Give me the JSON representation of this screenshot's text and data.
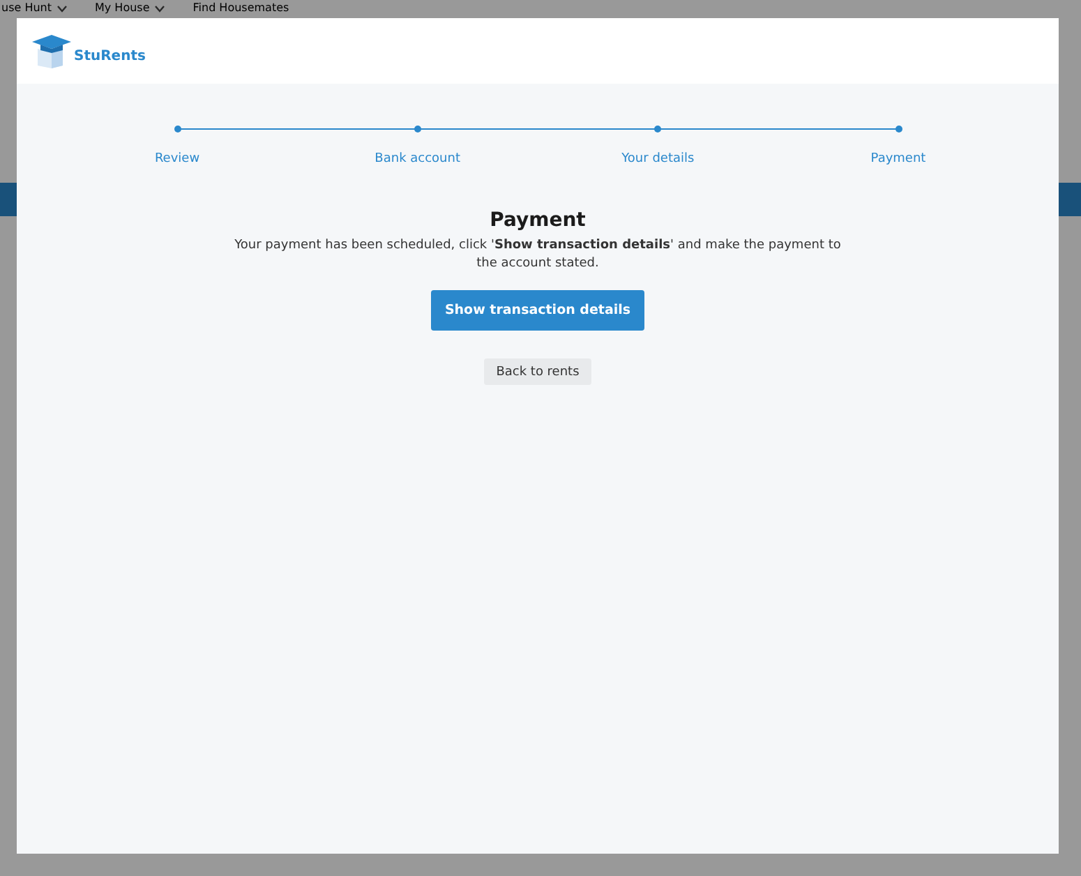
{
  "background_nav": [
    {
      "label": "use Hunt",
      "caret": true
    },
    {
      "label": "My House",
      "caret": true
    },
    {
      "label": "Find Housemates",
      "caret": false
    }
  ],
  "modal": {
    "logo": "StuRents",
    "steps": [
      {
        "label": "Review"
      },
      {
        "label": "Bank account"
      },
      {
        "label": "Your details"
      },
      {
        "label": "Payment"
      }
    ],
    "heading": "Payment",
    "message": "Your payment has been scheduled, click '**Show transaction details**' and make the payment to the account stated.",
    "primary_button": "Show transaction details",
    "secondary_button": "Back to rents"
  }
}
